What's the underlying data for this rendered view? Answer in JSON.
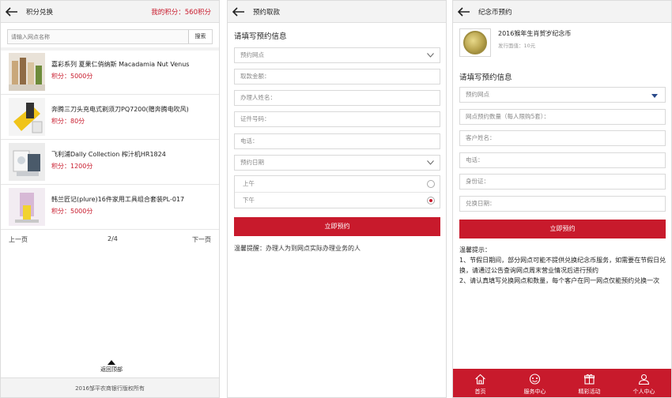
{
  "panel1": {
    "title": "积分兑换",
    "my_points": "我的积分：560积分",
    "search": {
      "placeholder": "请输入网点名称",
      "button": "搜索"
    },
    "products": [
      {
        "name": "嘉彩系列 夏果仁俏纳斯 Macadamia Nut Venus",
        "points": "积分：5000分"
      },
      {
        "name": "奔腾三刀头充电式剃须刀PQ7200(赠奔腾电吹风)",
        "points": "积分：80分"
      },
      {
        "name": "飞利浦Dally Collection 榨汁机HR1824",
        "points": "积分：1200分"
      },
      {
        "name": "韩兰匠记(plure)16件家用工具组合套装PL-017",
        "points": "积分：5000分"
      }
    ],
    "pager": {
      "prev": "上一页",
      "page": "2/4",
      "next": "下一页"
    },
    "back_to_top": "返回顶部",
    "footer": "2016邹平农商银行版权所有"
  },
  "panel2": {
    "title": "预约取款",
    "form_title": "请填写预约信息",
    "fields": {
      "branch": "预约网点",
      "amount": "取款金额：",
      "handler_name": "办理人姓名：",
      "id_number": "证件号码：",
      "phone": "电话：",
      "date": "预约日期"
    },
    "time_options": {
      "am": "上午",
      "pm": "下午"
    },
    "selected_time": "下午",
    "submit": "立即预约",
    "notice": "温馨提醒：办理人为到网点实际办理业务的人"
  },
  "panel3": {
    "title": "纪念币预约",
    "coin": {
      "name": "2016猴年生肖贺岁纪念币",
      "face_value": "发行面值：10元"
    },
    "form_title": "请填写预约信息",
    "fields": {
      "branch": "预约网点",
      "quantity": "网点预约数量（每人限购5套）：",
      "customer_name": "客户姓名：",
      "phone": "电话：",
      "id_card": "身份证：",
      "exchange_date": "兑换日期："
    },
    "submit": "立即预约",
    "tips_title": "温馨提示：",
    "tips": [
      "1、节假日期间，部分网点可能不提供兑换纪念币服务，如需要在节假日兑换，请通过公告查询网点周末营业情况后进行预约",
      "2、请认真填写兑换网点和数量，每个客户在同一网点仅能预约兑换一次"
    ],
    "tabbar": [
      {
        "label": "首页",
        "icon": "home-icon"
      },
      {
        "label": "服务中心",
        "icon": "service-icon"
      },
      {
        "label": "精彩活动",
        "icon": "gift-icon"
      },
      {
        "label": "个人中心",
        "icon": "user-icon"
      }
    ]
  },
  "colors": {
    "accent": "#c81a2c",
    "header_bg": "#f3f3f3",
    "select_caret": "#2a4a8a"
  }
}
